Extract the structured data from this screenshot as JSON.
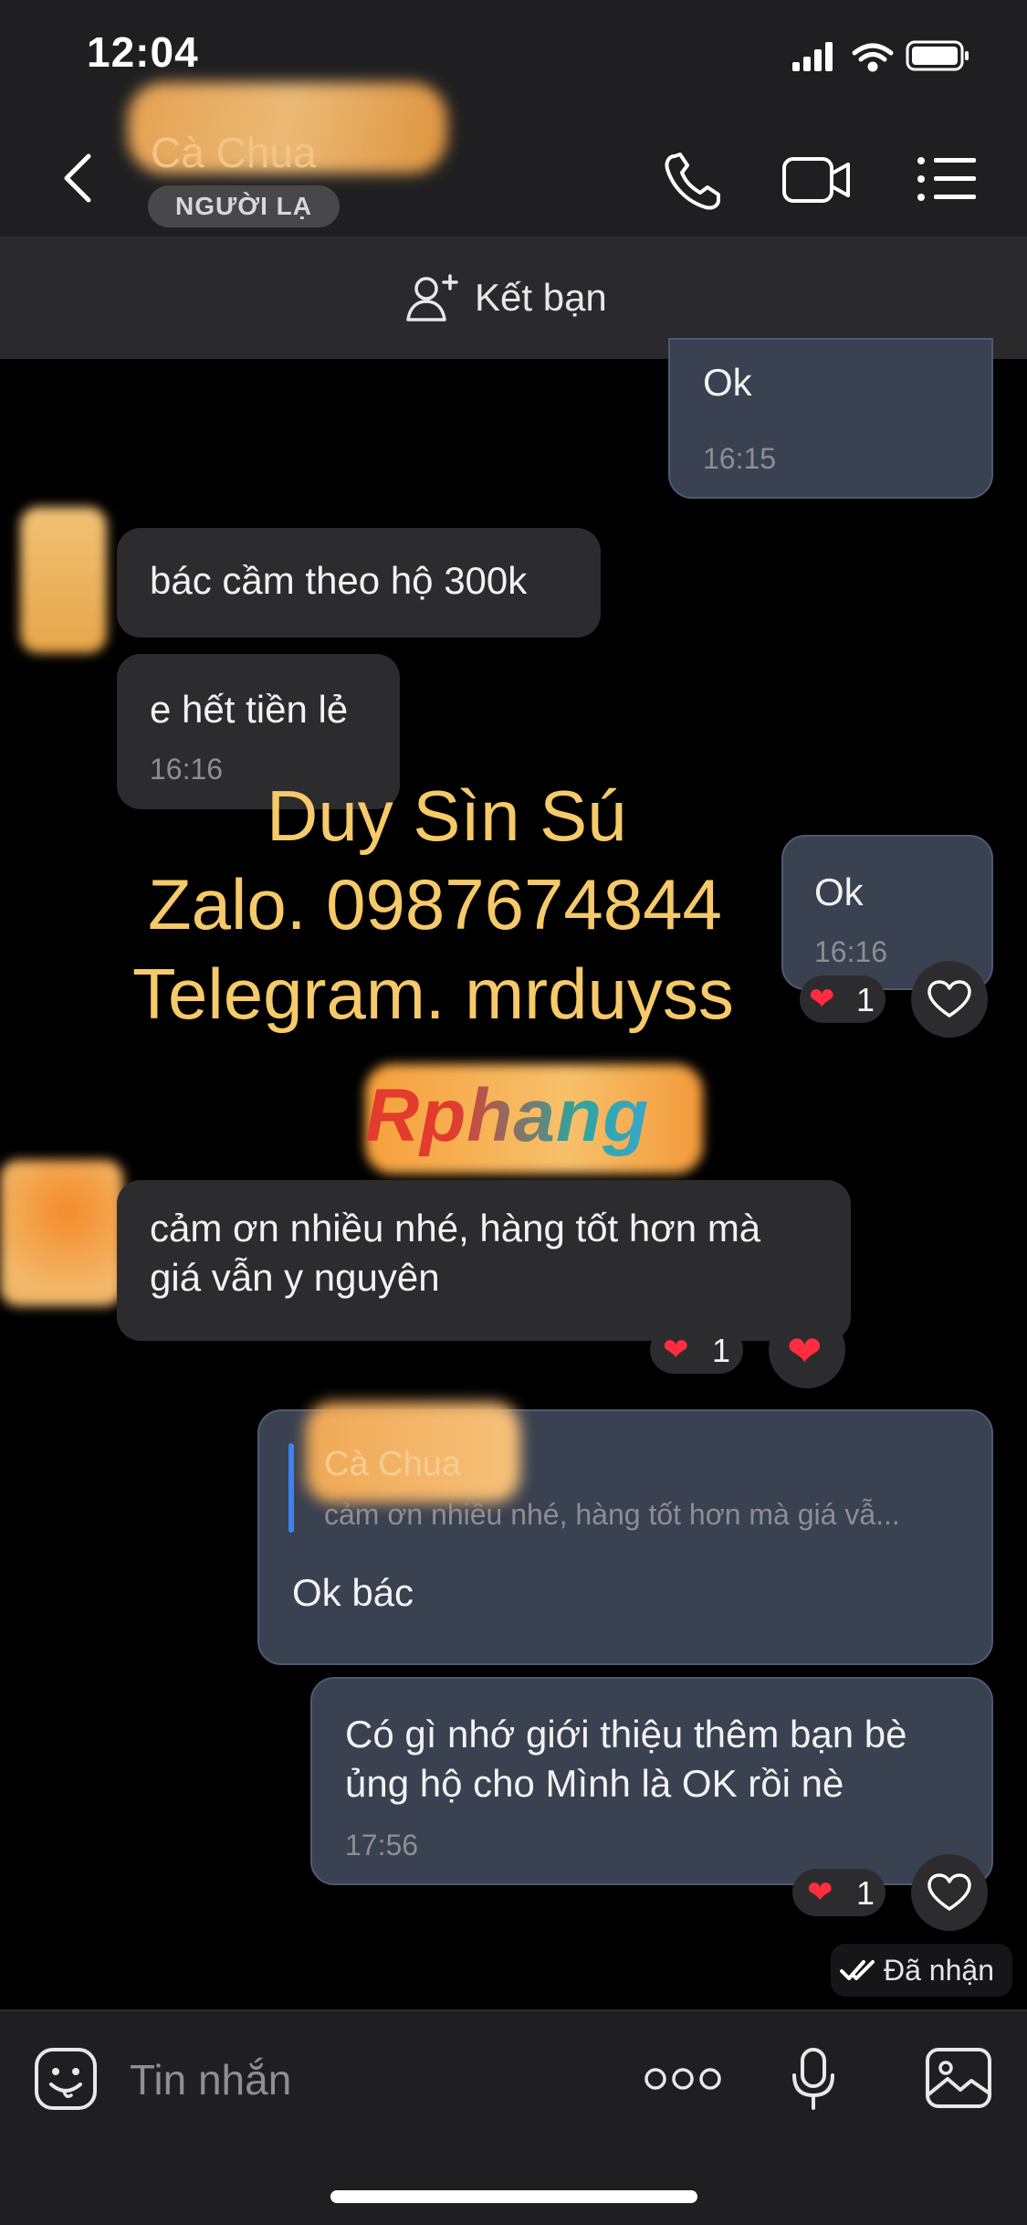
{
  "status_bar": {
    "time": "12:04"
  },
  "header": {
    "contact_name": "Cà Chua",
    "stranger_badge": "NGƯỜI LẠ",
    "add_friend_label": "Kết bạn"
  },
  "messages": [
    {
      "text": "Ok",
      "time": "16:15"
    },
    {
      "text": "bác cầm theo hộ 300k"
    },
    {
      "text": "e hết tiền lẻ",
      "time": "16:16"
    },
    {
      "text": "Ok",
      "time": "16:16",
      "reaction_count": "1"
    },
    {
      "text_line1": "cảm ơn nhiều nhé, hàng tốt hơn mà",
      "text_line2": "giá vẫn y nguyên",
      "reaction_count": "1"
    },
    {
      "quote_name": "Cà Chua",
      "quote_text": "cảm ơn nhiều nhé, hàng tốt hơn mà giá vẫ...",
      "text": "Ok bác"
    },
    {
      "text_line1": "Có gì nhớ giới thiệu thêm bạn bè",
      "text_line2": "ủng hộ cho Mình là OK rồi nè",
      "time": "17:56",
      "reaction_count": "1"
    }
  ],
  "read_status": "Đã nhận",
  "watermark": {
    "line1": "Duy Sìn Sú",
    "line2": "Zalo. 0987674844",
    "line3": "Telegram. mrduyss",
    "logo": "Rphang"
  },
  "composer": {
    "placeholder": "Tin nhắn"
  },
  "colors": {
    "background": "#000000",
    "incoming_bubble": "#2c2c2e",
    "outgoing_bubble": "#3a4150",
    "heart": "#ff2d3f",
    "watermark": "#f6c969"
  }
}
